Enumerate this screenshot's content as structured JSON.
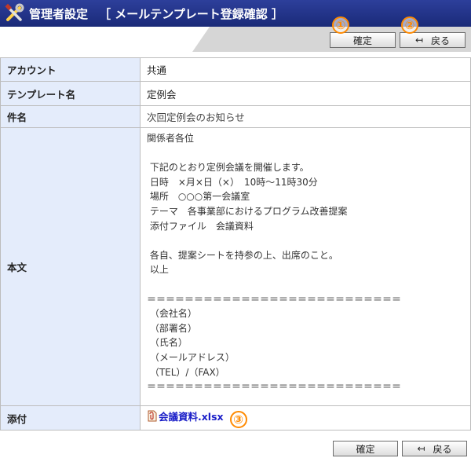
{
  "title": {
    "main": "管理者設定",
    "crumb": "［ メールテンプレート登録確認 ］"
  },
  "buttons": {
    "confirm": "確定",
    "back": "戻る",
    "back_icon": "return-arrow-icon"
  },
  "markers": {
    "m1": "①",
    "m2": "②",
    "m3": "③"
  },
  "rows": {
    "account": {
      "label": "アカウント",
      "value": "共通"
    },
    "template": {
      "label": "テンプレート名",
      "value": "定例会"
    },
    "subject": {
      "label": "件名",
      "value": "次回定例会のお知らせ"
    },
    "body": {
      "label": "本文",
      "value": "関係者各位\n\n 下記のとおり定例会議を開催します。\n 日時　×月×日（×）　10時～11時30分\n 場所　○○○第一会議室\n テーマ　各事業部におけるプログラム改善提案\n 添付ファイル　会議資料\n\n 各自、提案シートを持参の上、出席のこと。\n 以上\n\n＝＝＝＝＝＝＝＝＝＝＝＝＝＝＝＝＝＝＝＝＝＝＝＝＝＝＝\n （会社名）\n （部署名）\n （氏名）\n （メールアドレス）\n （TEL）/（FAX）\n＝＝＝＝＝＝＝＝＝＝＝＝＝＝＝＝＝＝＝＝＝＝＝＝＝＝＝"
    },
    "attachment": {
      "label": "添付",
      "file": "会議資料.xlsx",
      "icon": "attachment-file-icon"
    }
  },
  "colors": {
    "titlebar": "#2d3f9b",
    "label_bg": "#e4ecfb",
    "marker": "#ff8a00",
    "link": "#1a1ec8"
  }
}
